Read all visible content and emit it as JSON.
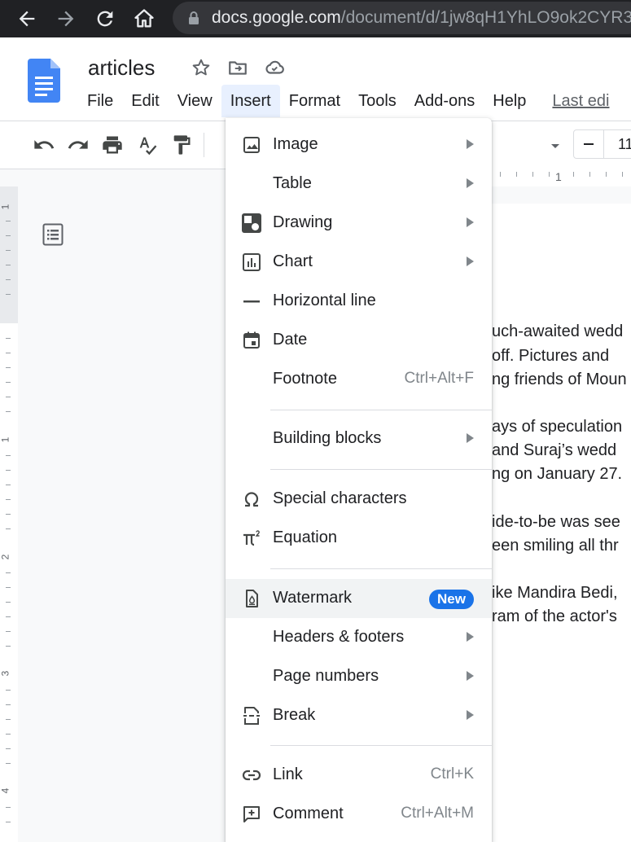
{
  "browser": {
    "url_host": "docs.google.com",
    "url_path": "/document/d/1jw8qH1YhLO9ok2CYR3"
  },
  "header": {
    "doc_title": "articles",
    "menus": [
      "File",
      "Edit",
      "View",
      "Insert",
      "Format",
      "Tools",
      "Add-ons",
      "Help"
    ],
    "last_edit": "Last edi"
  },
  "toolbar": {
    "font_size": "11"
  },
  "ruler": {
    "horizontal_label": "1",
    "vertical_labels": [
      "1",
      "1",
      "2",
      "3",
      "4"
    ]
  },
  "document": {
    "lines": [
      "uch-awaited wedd",
      "off. Pictures and",
      "ng friends of Moun",
      "ays of speculation",
      "and Suraj’s wedd",
      "ng on January 27.",
      "ide-to-be was see",
      "een smiling all thr",
      "ike Mandira Bedi,",
      "ram of the actor's"
    ]
  },
  "insert_menu": {
    "image": "Image",
    "table": "Table",
    "drawing": "Drawing",
    "chart": "Chart",
    "horizontal_line": "Horizontal line",
    "date": "Date",
    "footnote": "Footnote",
    "footnote_shortcut": "Ctrl+Alt+F",
    "building_blocks": "Building blocks",
    "special_characters": "Special characters",
    "equation": "Equation",
    "watermark": "Watermark",
    "watermark_badge": "New",
    "headers_footers": "Headers & footers",
    "page_numbers": "Page numbers",
    "break": "Break",
    "link": "Link",
    "link_shortcut": "Ctrl+K",
    "comment": "Comment",
    "comment_shortcut": "Ctrl+Alt+M"
  },
  "colors": {
    "accent": "#1a73e8",
    "menu_active_bg": "#e8f0fe",
    "hover_bg": "#f1f3f4",
    "docs_blue": "#4285f4"
  }
}
